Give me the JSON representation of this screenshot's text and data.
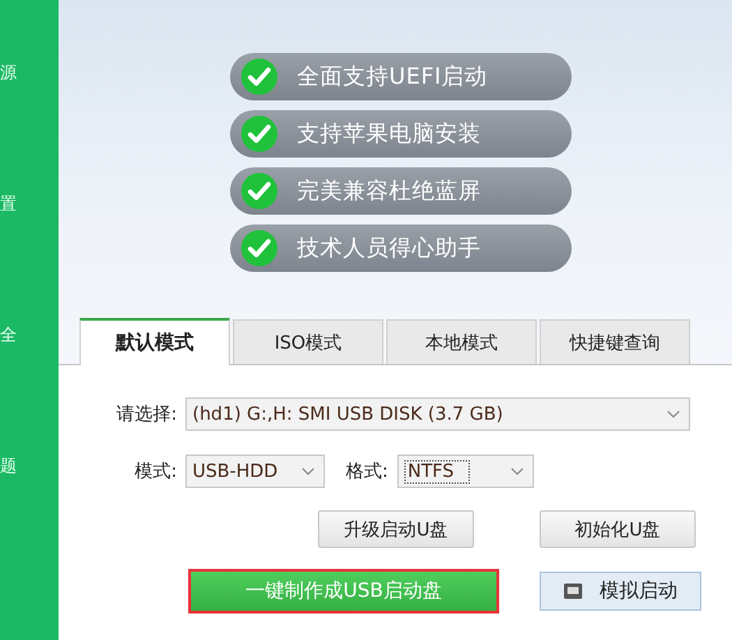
{
  "sidebar": {
    "items": [
      {
        "label": "源"
      },
      {
        "label": "置"
      },
      {
        "label": "全"
      },
      {
        "label": "题"
      }
    ]
  },
  "features": [
    {
      "text": "全面支持UEFI启动"
    },
    {
      "text": "支持苹果电脑安装"
    },
    {
      "text": "完美兼容杜绝蓝屏"
    },
    {
      "text": "技术人员得心助手"
    }
  ],
  "tabs": [
    {
      "label": "默认模式",
      "selected": true
    },
    {
      "label": "ISO模式",
      "selected": false
    },
    {
      "label": "本地模式",
      "selected": false
    },
    {
      "label": "快捷键查询",
      "selected": false
    }
  ],
  "form": {
    "device": {
      "label": "请选择:",
      "value": "(hd1) G:,H: SMI USB DISK (3.7 GB)"
    },
    "mode": {
      "label": "模式:",
      "value": "USB-HDD"
    },
    "format": {
      "label": "格式:",
      "value": "NTFS"
    }
  },
  "buttons": [
    {
      "label": "升级启动U盘",
      "kind": "plain",
      "highlighted": false
    },
    {
      "label": "初始化U盘",
      "kind": "plain",
      "highlighted": false
    },
    {
      "label": "一键制作成USB启动盘",
      "kind": "primary",
      "highlighted": true
    },
    {
      "label": "模拟启动",
      "kind": "simulate",
      "highlighted": false
    }
  ]
}
